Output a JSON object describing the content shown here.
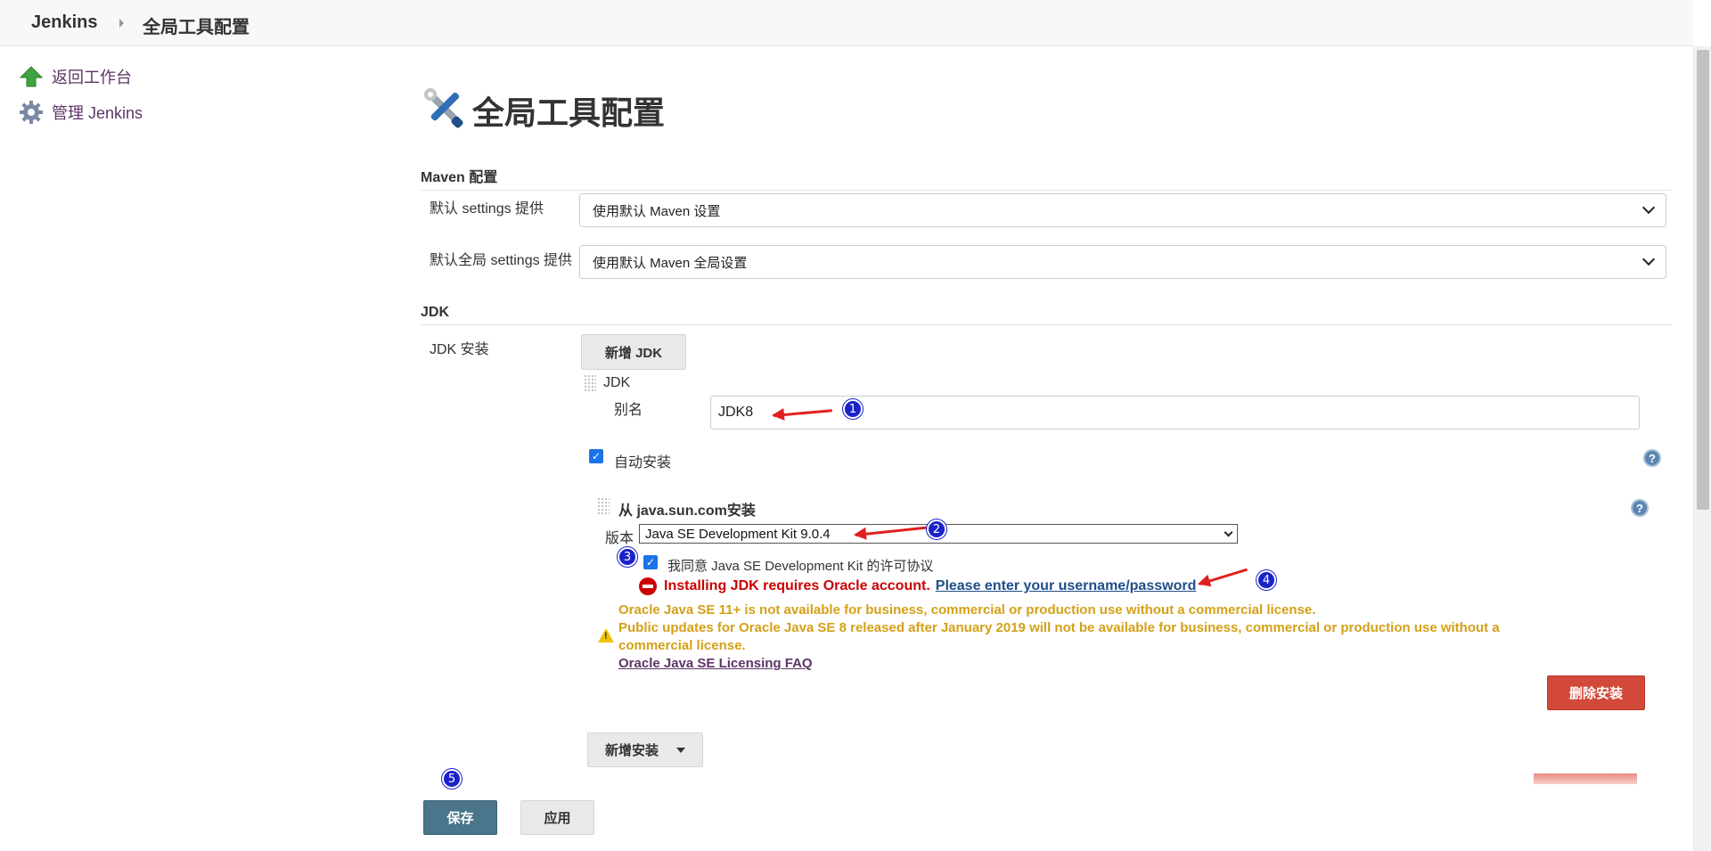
{
  "breadcrumb": {
    "home": "Jenkins",
    "current": "全局工具配置"
  },
  "sidebar": {
    "items": [
      {
        "label": "返回工作台",
        "icon": "up-arrow-icon"
      },
      {
        "label": "管理 Jenkins",
        "icon": "gear-icon"
      }
    ]
  },
  "page": {
    "title": "全局工具配置"
  },
  "maven": {
    "section_title": "Maven 配置",
    "settings_label": "默认 settings 提供",
    "settings_value": "使用默认 Maven 设置",
    "global_settings_label": "默认全局 settings 提供",
    "global_settings_value": "使用默认 Maven 全局设置"
  },
  "jdk": {
    "section_title": "JDK",
    "install_label": "JDK 安装",
    "add_button": "新增 JDK",
    "item_title": "JDK",
    "alias_label": "别名",
    "alias_value": "JDK8",
    "auto_install_label": "自动安装",
    "installer_title": "从 java.sun.com安装",
    "version_label": "版本",
    "version_value": "Java SE Development Kit 9.0.4",
    "agree_label": "我同意 Java SE Development Kit 的许可协议",
    "error_text": "Installing JDK requires Oracle account.",
    "error_link": "Please enter your username/password",
    "warning_line1": "Oracle Java SE 11+ is not available for business, commercial or production use without a commercial license.",
    "warning_line2": "Public updates for Oracle Java SE 8 released after January 2019 will not be available for business, commercial or production use without a",
    "warning_line3": "commercial license.",
    "warning_link": "Oracle Java SE Licensing FAQ",
    "delete_install_button": "删除安装",
    "add_install_button": "新增安装"
  },
  "footer": {
    "save_button": "保存",
    "apply_button": "应用"
  },
  "annotations": {
    "markers": [
      "1",
      "2",
      "3",
      "4",
      "5"
    ]
  },
  "colors": {
    "link_purple": "#5c3566",
    "error_red": "#cc0000",
    "warning_gold": "#d4a017",
    "save_blue": "#4b758b",
    "delete_red": "#d24939",
    "annotation_arrow": "#e02020",
    "marker_blue": "#1a22c9"
  }
}
